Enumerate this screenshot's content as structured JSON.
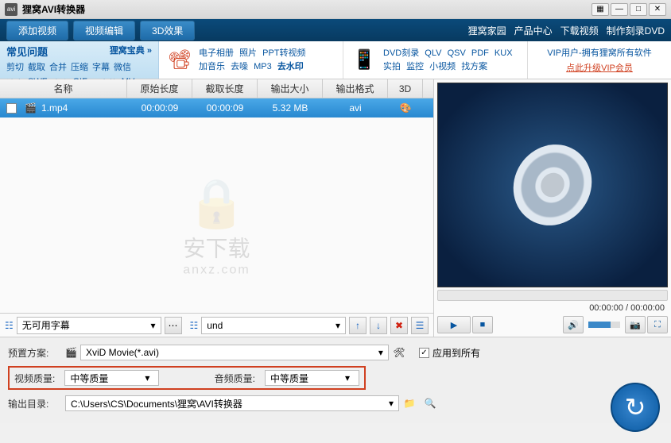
{
  "title": "狸窝AVI转换器",
  "toolbar": {
    "add_video": "添加视频",
    "video_edit": "视频编辑",
    "effect_3d": "3D效果",
    "links": [
      "狸窝家园",
      "产品中心",
      "下载视频",
      "制作刻录DVD"
    ]
  },
  "tips": {
    "faq_title": "常见问题",
    "baodian": "狸窝宝典 »",
    "tags": [
      "剪切",
      "截取",
      "合并",
      "压缩",
      "字幕",
      "微信",
      "消音",
      "SWF",
      "片头",
      "GIF",
      "双音轨",
      "MV"
    ],
    "section1": [
      "电子相册",
      "照片",
      "PPT转视频",
      "加音乐",
      "去噪",
      "MP3",
      "去水印"
    ],
    "section2": [
      "DVD刻录",
      "QLV",
      "QSV",
      "PDF",
      "KUX",
      "实拍",
      "监控",
      "小视频",
      "找方案"
    ],
    "vip_text": "VIP用户-拥有狸窝所有软件",
    "vip_link": "点此升级VIP会员"
  },
  "columns": {
    "name": "名称",
    "original_length": "原始长度",
    "clip_length": "截取长度",
    "output_size": "输出大小",
    "output_format": "输出格式",
    "three_d": "3D"
  },
  "file": {
    "name": "1.mp4",
    "original_length": "00:00:09",
    "clip_length": "00:00:09",
    "output_size": "5.32 MB",
    "output_format": "avi"
  },
  "subtitle": {
    "none": "无可用字幕",
    "und": "und"
  },
  "preview": {
    "time": "00:00:00 / 00:00:00"
  },
  "settings": {
    "preset_label": "预置方案:",
    "preset_value": "XviD Movie(*.avi)",
    "apply_all": "应用到所有",
    "video_quality_label": "视频质量:",
    "video_quality_value": "中等质量",
    "audio_quality_label": "音频质量:",
    "audio_quality_value": "中等质量",
    "output_label": "输出目录:",
    "output_value": "C:\\Users\\CS\\Documents\\狸窝\\AVI转换器"
  }
}
